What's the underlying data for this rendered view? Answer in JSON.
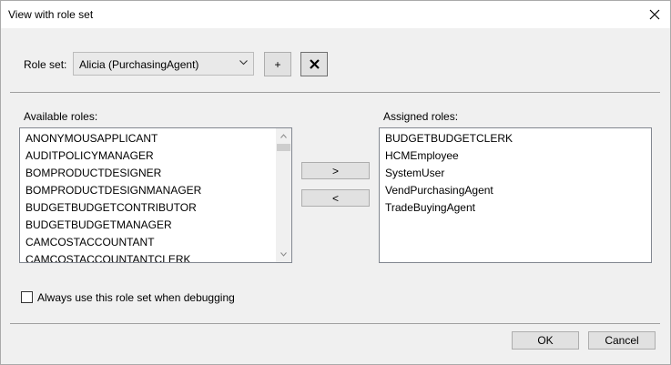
{
  "window": {
    "title": "View with role set"
  },
  "roleset": {
    "label": "Role set:",
    "selected": "Alicia (PurchasingAgent)",
    "add_label": "+"
  },
  "available": {
    "label": "Available roles:",
    "items": [
      "ANONYMOUSAPPLICANT",
      "AUDITPOLICYMANAGER",
      "BOMPRODUCTDESIGNER",
      "BOMPRODUCTDESIGNMANAGER",
      "BUDGETBUDGETCONTRIBUTOR",
      "BUDGETBUDGETMANAGER",
      "CAMCOSTACCOUNTANT",
      "CAMCOSTACCOUNTANTCLERK"
    ]
  },
  "assigned": {
    "label": "Assigned roles:",
    "items": [
      "BUDGETBUDGETCLERK",
      "HCMEmployee",
      "SystemUser",
      "VendPurchasingAgent",
      "TradeBuyingAgent"
    ]
  },
  "move": {
    "add_label": ">",
    "remove_label": "<"
  },
  "debug": {
    "checkbox_label": "Always use this role set when debugging",
    "checked": false
  },
  "footer": {
    "ok_label": "OK",
    "cancel_label": "Cancel"
  }
}
